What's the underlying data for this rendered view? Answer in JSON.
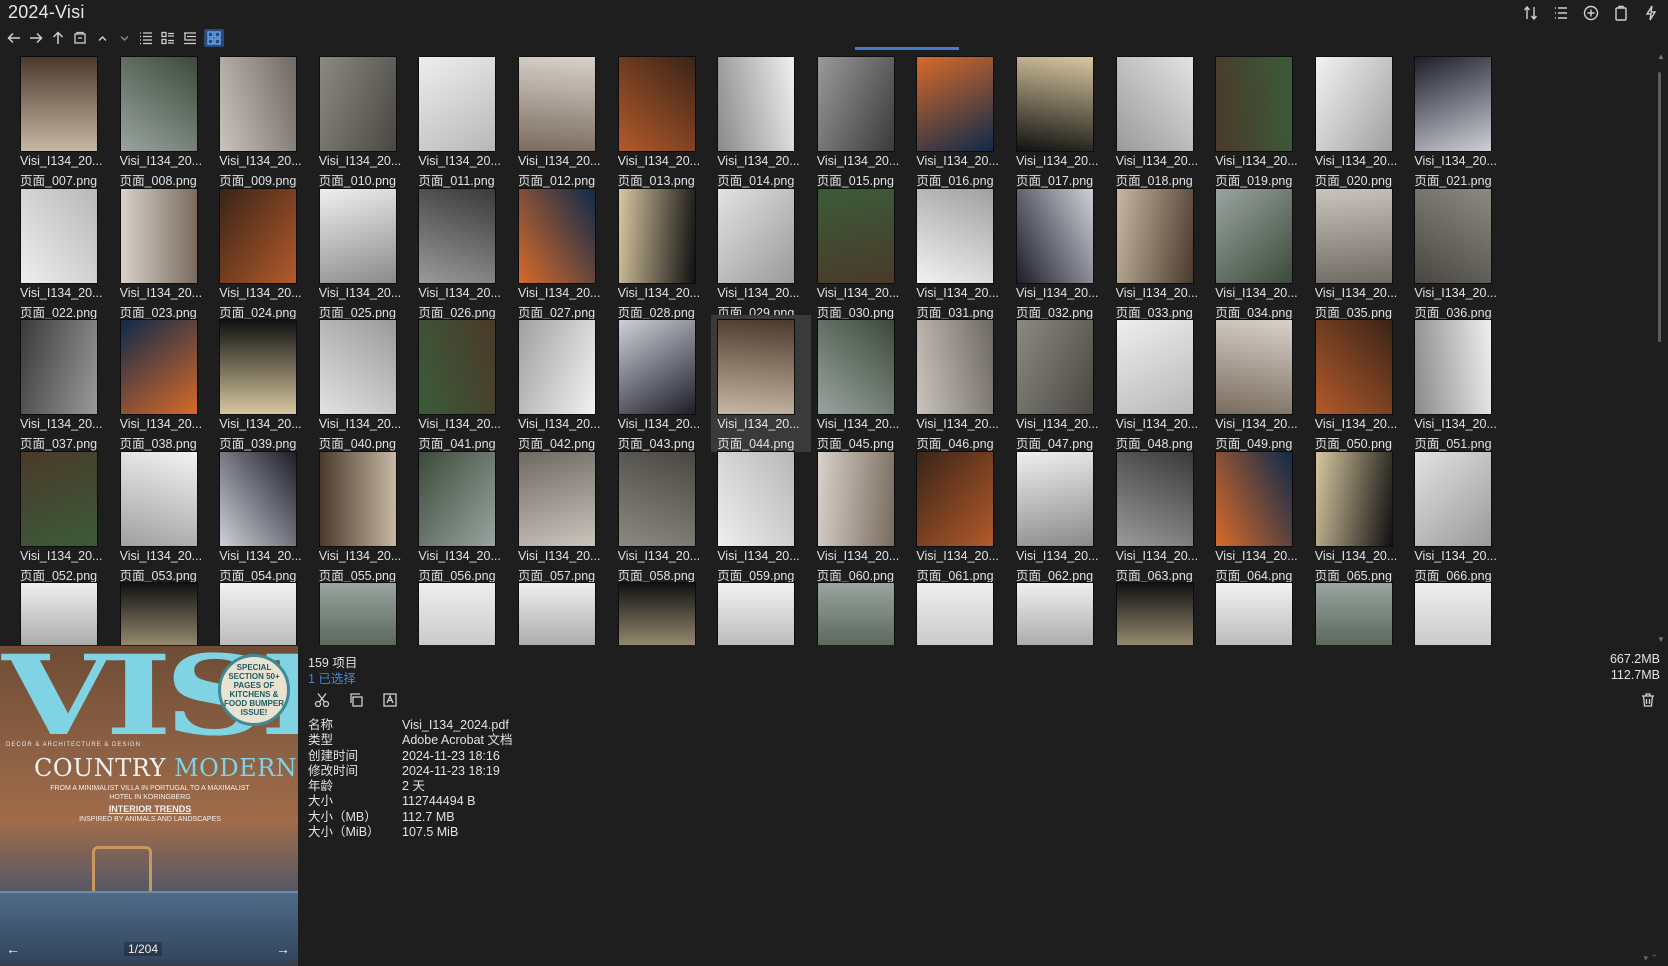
{
  "window": {
    "title": "2024-Visi"
  },
  "toolbar": {
    "buttons": [
      "back-arrow-icon",
      "forward-arrow-icon",
      "up-arrow-icon",
      "folder-icon",
      "chevron-up-icon",
      "chevron-down-icon",
      "view-list-icon",
      "view-details-icon",
      "view-tree-icon",
      "view-grid-icon"
    ],
    "active_view": "view-grid-icon"
  },
  "top_right_icons": [
    "sort-icon",
    "list-icon",
    "add-icon",
    "clipboard-icon",
    "flash-icon"
  ],
  "colors": {
    "background": "#1e1e1e",
    "accent": "#3f7cd1",
    "selected_text": "#3f86d8",
    "selected_tile": "#3a3a3a"
  },
  "grid": {
    "caption_prefix": "Visi_I134_20...",
    "rows": [
      [
        "页面_007.png",
        "页面_008.png",
        "页面_009.png",
        "页面_010.png",
        "页面_011.png",
        "页面_012.png",
        "页面_013.png",
        "页面_014.png",
        "页面_015.png",
        "页面_016.png",
        "页面_017.png",
        "页面_018.png",
        "页面_019.png",
        "页面_020.png",
        "页面_021.png"
      ],
      [
        "页面_022.png",
        "页面_023.png",
        "页面_024.png",
        "页面_025.png",
        "页面_026.png",
        "页面_027.png",
        "页面_028.png",
        "页面_029.png",
        "页面_030.png",
        "页面_031.png",
        "页面_032.png",
        "页面_033.png",
        "页面_034.png",
        "页面_035.png",
        "页面_036.png"
      ],
      [
        "页面_037.png",
        "页面_038.png",
        "页面_039.png",
        "页面_040.png",
        "页面_041.png",
        "页面_042.png",
        "页面_043.png",
        "页面_044.png",
        "页面_045.png",
        "页面_046.png",
        "页面_047.png",
        "页面_048.png",
        "页面_049.png",
        "页面_050.png",
        "页面_051.png"
      ],
      [
        "页面_052.png",
        "页面_053.png",
        "页面_054.png",
        "页面_055.png",
        "页面_056.png",
        "页面_057.png",
        "页面_058.png",
        "页面_059.png",
        "页面_060.png",
        "页面_061.png",
        "页面_062.png",
        "页面_063.png",
        "页面_064.png",
        "页面_065.png",
        "页面_066.png"
      ]
    ],
    "selected": "页面_044.png"
  },
  "preview": {
    "logo": "VISI",
    "tagline": "DECOR & ARCHITECTURE & DESIGN",
    "seal": "SPECIAL SECTION 50+ PAGES OF KITCHENS & FOOD BUMPER ISSUE!",
    "headline_a": "COUNTRY",
    "headline_b": "MODERN",
    "sub": "FROM A MINIMALIST VILLA IN PORTUGAL TO A MAXIMALIST HOTEL IN KORINGBERG",
    "trends": "INTERIOR TRENDS",
    "trends_sub": "INSPIRED BY ANIMALS AND LANDSCAPES",
    "page_counter": "1/204"
  },
  "details": {
    "count": "159 项目",
    "selected": "1 已选择",
    "size_total": "667.2MB",
    "size_selected": "112.7MB",
    "properties": [
      {
        "key": "名称",
        "value": "Visi_I134_2024.pdf"
      },
      {
        "key": "类型",
        "value": "Adobe Acrobat 文档"
      },
      {
        "key": "创建时间",
        "value": "2024-11-23  18:16"
      },
      {
        "key": "修改时间",
        "value": "2024-11-23  18:19"
      },
      {
        "key": "年龄",
        "value": "2 天"
      },
      {
        "key": "大小",
        "value": "112744494 B"
      },
      {
        "key": "大小（MB）",
        "value": "112.7 MB"
      },
      {
        "key": "大小（MiB）",
        "value": "107.5 MiB"
      }
    ]
  }
}
